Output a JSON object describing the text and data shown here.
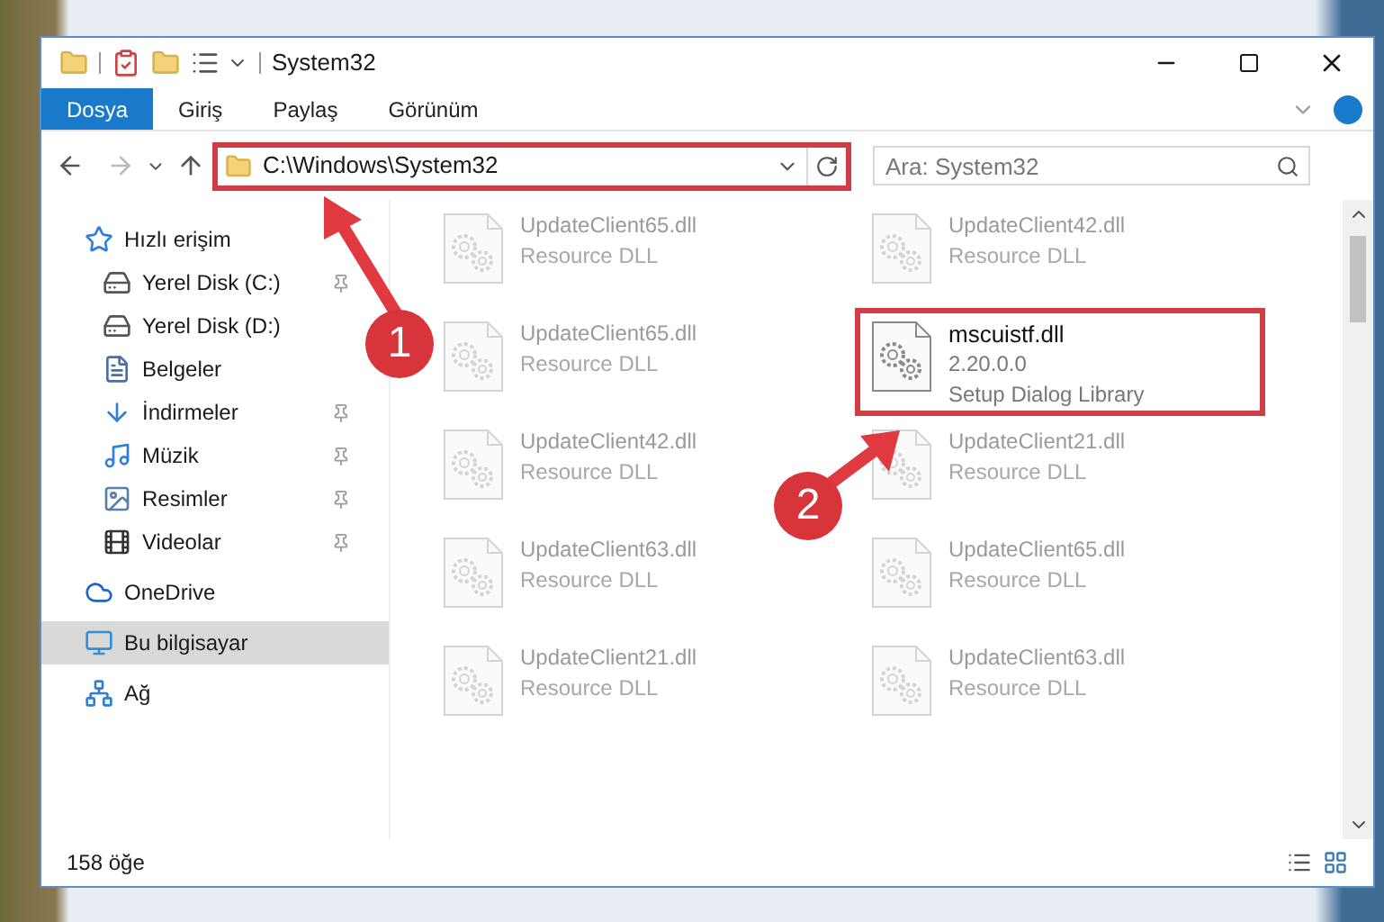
{
  "window": {
    "title": "System32"
  },
  "ribbon_tabs": [
    {
      "label": "Dosya",
      "selected": true
    },
    {
      "label": "Giriş",
      "selected": false
    },
    {
      "label": "Paylaş",
      "selected": false
    },
    {
      "label": "Görünüm",
      "selected": false
    }
  ],
  "address": {
    "path": "C:\\Windows\\System32"
  },
  "search": {
    "placeholder": "Ara: System32"
  },
  "sidebar": {
    "items": [
      {
        "label": "Hızlı erişim",
        "kind": "star",
        "pinned": false,
        "selected": false,
        "group": true
      },
      {
        "label": "Yerel Disk (C:)",
        "kind": "drive",
        "pinned": true,
        "selected": false,
        "group": false
      },
      {
        "label": "Yerel Disk (D:)",
        "kind": "drive",
        "pinned": false,
        "selected": false,
        "group": false
      },
      {
        "label": "Belgeler",
        "kind": "document",
        "pinned": false,
        "selected": false,
        "group": false
      },
      {
        "label": "İndirmeler",
        "kind": "download",
        "pinned": true,
        "selected": false,
        "group": false
      },
      {
        "label": "Müzik",
        "kind": "music",
        "pinned": true,
        "selected": false,
        "group": false
      },
      {
        "label": "Resimler",
        "kind": "image",
        "pinned": true,
        "selected": false,
        "group": false
      },
      {
        "label": "Videolar",
        "kind": "video",
        "pinned": true,
        "selected": false,
        "group": false
      },
      {
        "label": "OneDrive",
        "kind": "cloud",
        "pinned": false,
        "selected": false,
        "group": true
      },
      {
        "label": "Bu bilgisayar",
        "kind": "computer",
        "pinned": false,
        "selected": true,
        "group": true
      },
      {
        "label": "Ağ",
        "kind": "network",
        "pinned": false,
        "selected": false,
        "group": true
      }
    ]
  },
  "files": [
    {
      "name": "UpdateClient65.dll",
      "lines": [
        "Resource DLL"
      ],
      "kind": "faded"
    },
    {
      "name": "UpdateClient42.dll",
      "lines": [
        "Resource DLL"
      ],
      "kind": "faded"
    },
    {
      "name": "UpdateClient65.dll",
      "lines": [
        "Resource DLL"
      ],
      "kind": "faded"
    },
    {
      "name": "mscuistf.dll",
      "lines": [
        "2.20.0.0",
        "Setup Dialog Library"
      ],
      "kind": "focus"
    },
    {
      "name": "UpdateClient42.dll",
      "lines": [
        "Resource DLL"
      ],
      "kind": "faded"
    },
    {
      "name": "UpdateClient21.dll",
      "lines": [
        "Resource DLL"
      ],
      "kind": "faded"
    },
    {
      "name": "UpdateClient63.dll",
      "lines": [
        "Resource DLL"
      ],
      "kind": "faded"
    },
    {
      "name": "UpdateClient65.dll",
      "lines": [
        "Resource DLL"
      ],
      "kind": "faded"
    },
    {
      "name": "UpdateClient21.dll",
      "lines": [
        "Resource DLL"
      ],
      "kind": "faded"
    },
    {
      "name": "UpdateClient63.dll",
      "lines": [
        "Resource DLL"
      ],
      "kind": "faded"
    }
  ],
  "status_bar": {
    "count": "158 öğe"
  },
  "annotations": [
    {
      "label": "1"
    },
    {
      "label": "2"
    }
  ]
}
